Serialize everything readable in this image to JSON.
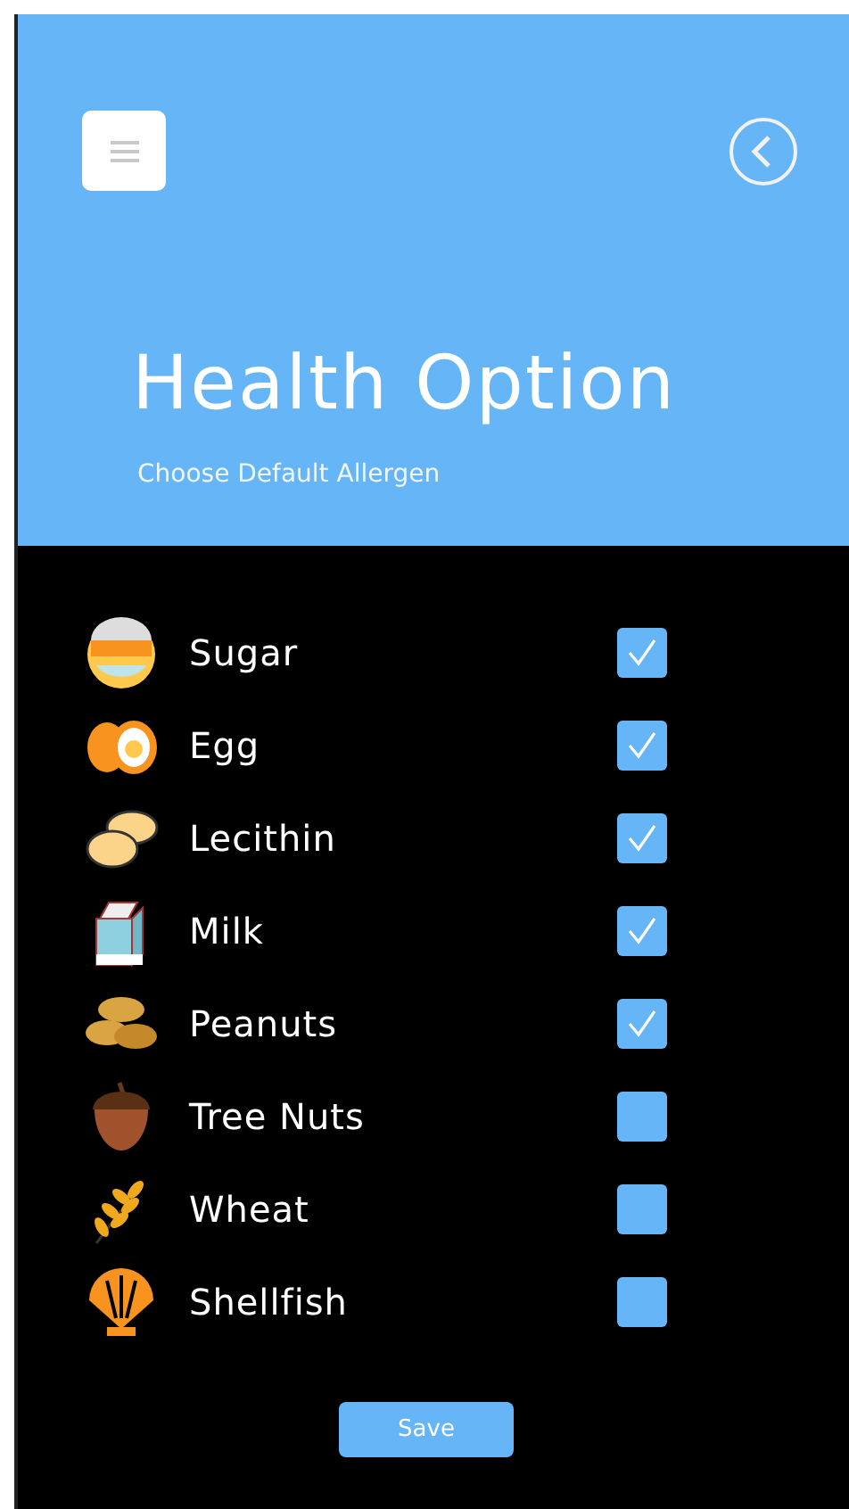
{
  "header": {
    "title": "Health Option",
    "subtitle": "Choose Default Allergen"
  },
  "allergens": [
    {
      "kind": "sugar",
      "label": "Sugar",
      "checked": true
    },
    {
      "kind": "egg",
      "label": "Egg",
      "checked": true
    },
    {
      "kind": "bean",
      "label": "Lecithin",
      "checked": true
    },
    {
      "kind": "milk",
      "label": "Milk",
      "checked": true
    },
    {
      "kind": "peanut",
      "label": "Peanuts",
      "checked": true
    },
    {
      "kind": "acorn",
      "label": "Tree Nuts",
      "checked": false
    },
    {
      "kind": "wheat",
      "label": "Wheat",
      "checked": false
    },
    {
      "kind": "shell",
      "label": "Shellfish",
      "checked": false
    }
  ],
  "save_button": "Save"
}
